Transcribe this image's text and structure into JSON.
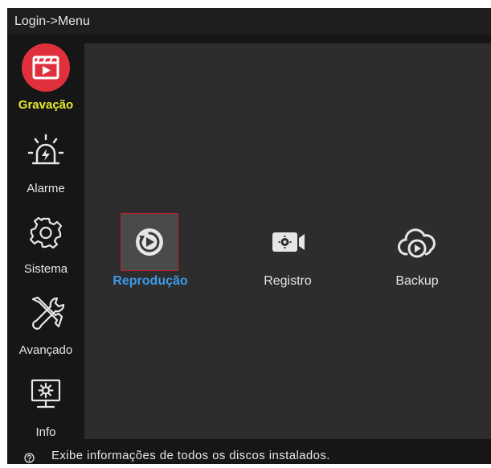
{
  "breadcrumb": "Login->Menu",
  "sidebar": {
    "items": [
      {
        "label": "Gravação",
        "icon": "recording-icon",
        "active": true
      },
      {
        "label": "Alarme",
        "icon": "alarm-icon"
      },
      {
        "label": "Sistema",
        "icon": "gear-icon"
      },
      {
        "label": "Avançado",
        "icon": "tools-icon"
      },
      {
        "label": "Info",
        "icon": "info-monitor-icon"
      }
    ]
  },
  "main": {
    "tiles": [
      {
        "label": "Reprodução",
        "icon": "playback-icon",
        "selected": true
      },
      {
        "label": "Registro",
        "icon": "video-camera-icon"
      },
      {
        "label": "Backup",
        "icon": "cloud-play-icon"
      }
    ]
  },
  "status": {
    "text": "Exibe informações de todos os discos instalados.",
    "icon": "help-icon"
  },
  "colors": {
    "active_nav": "#e8ea2e",
    "selected_tile": "#3d9ae8",
    "record_red": "#e0303c",
    "selection_border": "#c0202e"
  }
}
